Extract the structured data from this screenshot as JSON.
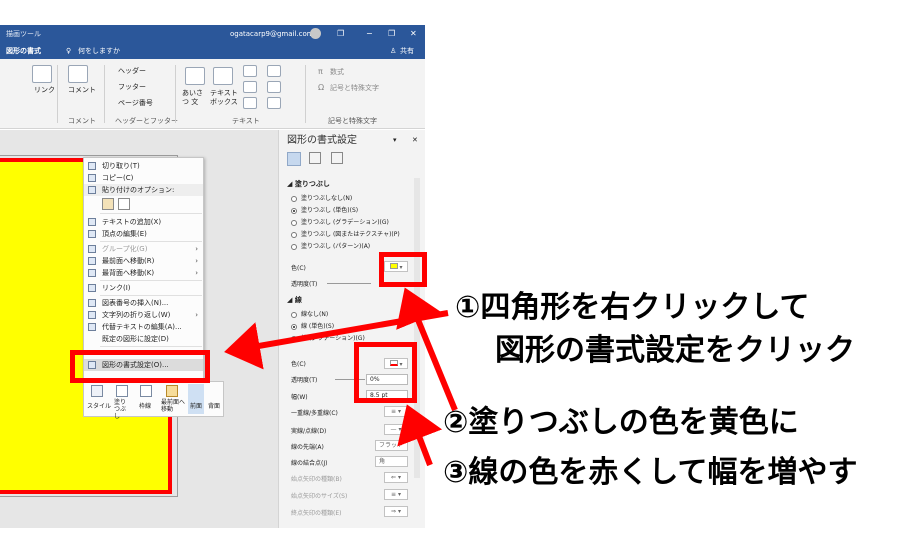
{
  "window": {
    "context_tab": "描画ツール",
    "account": "ogatacarp9@gmail.com",
    "format_tab": "図形の書式",
    "tell_me": "何をしますか",
    "share": "共有",
    "minimize": "−",
    "restore": "❐",
    "close": "✕"
  },
  "ribbon": {
    "link_label": "リンク",
    "comment_label": "コメント",
    "header_label": "ヘッダー",
    "footer_label": "フッター",
    "page_number_label": "ページ番号",
    "textbox_label": "テキスト ボックス",
    "equation_label": "数式",
    "symbol_label": "記号と特殊文字",
    "aisatsu_label": "あいさつ 文",
    "group_comment": "コメント",
    "group_header_footer": "ヘッダーとフッター",
    "group_text": "テキスト",
    "group_symbols": "記号と特殊文字"
  },
  "context_menu": {
    "items": [
      {
        "label": "切り取り(T)"
      },
      {
        "label": "コピー(C)"
      },
      {
        "label": "貼り付けのオプション:"
      },
      {
        "label": "テキストの追加(X)"
      },
      {
        "label": "頂点の編集(E)"
      },
      {
        "label": "グループ化(G)"
      },
      {
        "label": "最前面へ移動(R)"
      },
      {
        "label": "最背面へ移動(K)"
      },
      {
        "label": "リンク(I)"
      },
      {
        "label": "図表番号の挿入(N)..."
      },
      {
        "label": "文字列の折り返し(W)"
      },
      {
        "label": "代替テキストの編集(A)..."
      },
      {
        "label": "既定の図形に設定(D)"
      },
      {
        "label": "図形の書式設定(O)..."
      }
    ],
    "mini_toolbar": {
      "style": "スタイル",
      "fill": "塗りつぶし",
      "outline": "枠線",
      "bring_front": "最前面へ移動",
      "front": "前面",
      "back": "背面"
    }
  },
  "task_pane": {
    "title": "図形の書式設定",
    "fill_section": "塗りつぶし",
    "fill_options": [
      {
        "label": "塗りつぶしなし(N)",
        "selected": false
      },
      {
        "label": "塗りつぶし (単色)(S)",
        "selected": true
      },
      {
        "label": "塗りつぶし (グラデーション)(G)",
        "selected": false
      },
      {
        "label": "塗りつぶし (図またはテクスチャ)(P)",
        "selected": false
      },
      {
        "label": "塗りつぶし (パターン)(A)",
        "selected": false
      }
    ],
    "fill_color_label": "色(C)",
    "fill_transparency_label": "透明度(T)",
    "line_section": "線",
    "line_options": [
      {
        "label": "線なし(N)",
        "selected": false
      },
      {
        "label": "線 (単色)(S)",
        "selected": true
      },
      {
        "label": "線 (グラデーション)(G)",
        "selected": false
      }
    ],
    "line_color_label": "色(C)",
    "line_transparency_label": "透明度(T)",
    "line_transparency_value": "0%",
    "width_label": "幅(W)",
    "width_value": "8.5 pt",
    "compound_label": "一重線/多重線(C)",
    "dash_label": "実線/点線(D)",
    "cap_label": "線の先端(A)",
    "cap_value": "フラット",
    "join_label": "線の結合点(J)",
    "join_value": "角",
    "begin_arrow_type": "始点矢印の種類(B)",
    "begin_arrow_size": "始点矢印のサイズ(S)",
    "end_arrow_type": "終点矢印の種類(E)"
  },
  "annotations": {
    "step1_line1": "①四角形を右クリックして",
    "step1_line2": "図形の書式設定をクリック",
    "step2": "②塗りつぶしの色を黄色に",
    "step3": "③線の色を赤くして幅を増やす"
  },
  "colors": {
    "accent": "#2b579a",
    "annotation_red": "#ff0000",
    "shape_fill": "#ffff00",
    "shape_line": "#ff0000"
  }
}
